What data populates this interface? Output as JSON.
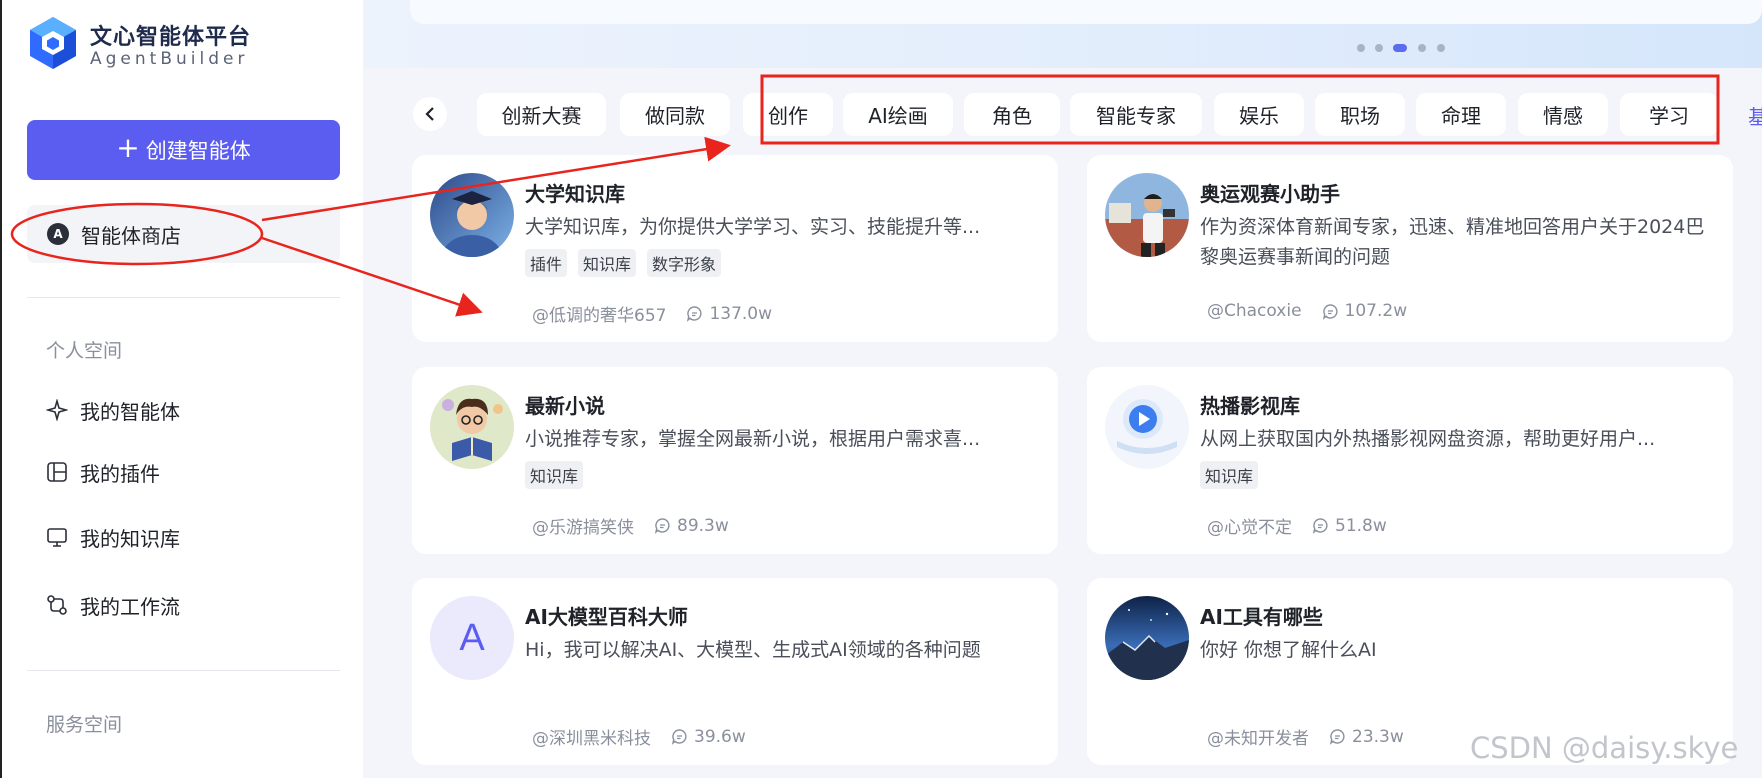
{
  "sidebar": {
    "logo_title": "文心智能体平台",
    "logo_subtitle": "AgentBuilder",
    "create_label": "创建智能体",
    "store_label": "智能体商店",
    "store_icon_letter": "A",
    "personal_section": "个人空间",
    "nav": [
      {
        "label": "我的智能体",
        "icon": "sparkle-icon"
      },
      {
        "label": "我的插件",
        "icon": "plugin-icon"
      },
      {
        "label": "我的知识库",
        "icon": "knowledge-base-icon"
      },
      {
        "label": "我的工作流",
        "icon": "workflow-icon"
      }
    ],
    "service_section": "服务空间"
  },
  "categories": [
    "创新大赛",
    "做同款",
    "创作",
    "AI绘画",
    "角色",
    "智能专家",
    "娱乐",
    "职场",
    "命理",
    "情感",
    "学习",
    "基"
  ],
  "agents": [
    {
      "title": "大学知识库",
      "desc": "大学知识库，为你提供大学学习、实习、技能提升等...",
      "tags": [
        "插件",
        "知识库",
        "数字形象"
      ],
      "author": "@低调的奢华657",
      "count": "137.0w"
    },
    {
      "title": "奥运观赛小助手",
      "desc": "作为资深体育新闻专家，迅速、精准地回答用户关于2024巴黎奥运赛事新闻的问题",
      "tags": [],
      "author": "@Chacoxie",
      "count": "107.2w"
    },
    {
      "title": "最新小说",
      "desc": "小说推荐专家，掌握全网最新小说，根据用户需求喜...",
      "tags": [
        "知识库"
      ],
      "author": "@乐游搞笑侠",
      "count": "89.3w"
    },
    {
      "title": "热播影视库",
      "desc": "从网上获取国内外热播影视网盘资源，帮助更好用户...",
      "tags": [
        "知识库"
      ],
      "author": "@心觉不定",
      "count": "51.8w"
    },
    {
      "title": "AI大模型百科大师",
      "desc": "Hi，我可以解决AI、大模型、生成式AI领域的各种问题",
      "tags": [],
      "author": "@深圳黑米科技",
      "count": "39.6w",
      "avatar_letter": "A"
    },
    {
      "title": "AI工具有哪些",
      "desc": "你好 你想了解什么AI",
      "tags": [],
      "author": "@未知开发者",
      "count": "23.3w"
    }
  ],
  "watermark": "CSDN @daisy.skye",
  "colors": {
    "accent": "#5b5cf0",
    "annotation": "#e8241c"
  }
}
